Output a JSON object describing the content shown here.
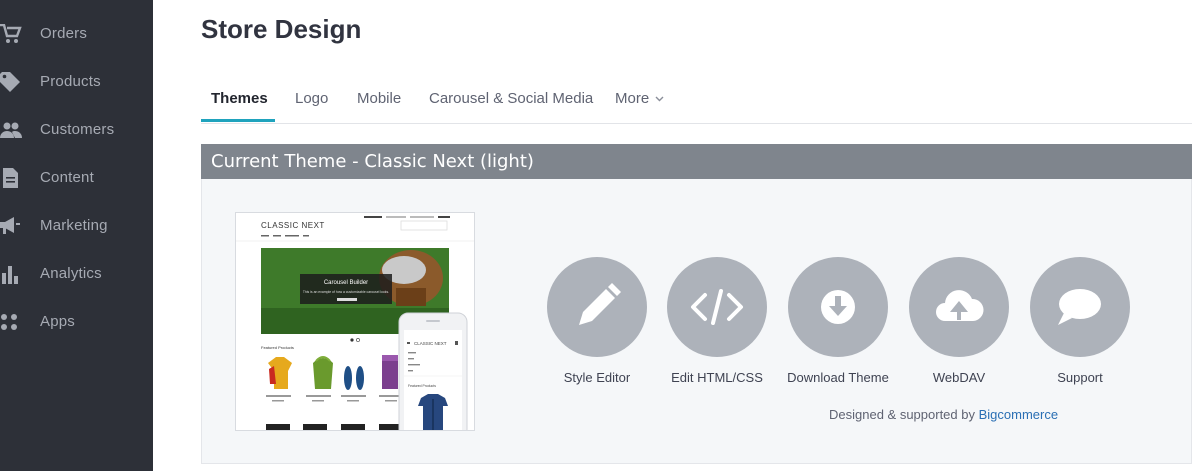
{
  "sidebar": {
    "items": [
      {
        "label": "Orders",
        "icon": "cart-icon"
      },
      {
        "label": "Products",
        "icon": "tag-icon"
      },
      {
        "label": "Customers",
        "icon": "people-icon"
      },
      {
        "label": "Content",
        "icon": "document-icon"
      },
      {
        "label": "Marketing",
        "icon": "megaphone-icon"
      },
      {
        "label": "Analytics",
        "icon": "bar-chart-icon"
      },
      {
        "label": "Apps",
        "icon": "apps-grid-icon"
      }
    ]
  },
  "header": {
    "title": "Store Design"
  },
  "tabs": [
    {
      "label": "Themes",
      "active": true
    },
    {
      "label": "Logo"
    },
    {
      "label": "Mobile"
    },
    {
      "label": "Carousel & Social Media"
    },
    {
      "label": "More",
      "icon": "chevron-down-icon"
    }
  ],
  "current_theme": {
    "header": "Current Theme - Classic Next (light)",
    "preview": {
      "store_name": "CLASSIC NEXT",
      "carousel_title": "Carousel Builder",
      "carousel_text": "This is an example of how a customizable carousel looks.",
      "featured_label": "Featured Products",
      "mobile_store_name": "CLASSIC NEXT",
      "mobile_featured_label": "Featured Products"
    },
    "actions": [
      {
        "label": "Style Editor",
        "icon": "pencil-icon"
      },
      {
        "label": "Edit HTML/CSS",
        "icon": "code-icon"
      },
      {
        "label": "Download Theme",
        "icon": "download-icon"
      },
      {
        "label": "WebDAV",
        "icon": "cloud-upload-icon"
      },
      {
        "label": "Support",
        "icon": "speech-bubble-icon"
      }
    ],
    "credit_prefix": "Designed & supported by",
    "credit_link": "Bigcommerce"
  },
  "colors": {
    "sidebar_bg": "#2d3038",
    "accent": "#1fa3bd",
    "panel_header_bg": "#7f858d",
    "action_circle": "#adb2ba",
    "link": "#2a6fb4"
  }
}
